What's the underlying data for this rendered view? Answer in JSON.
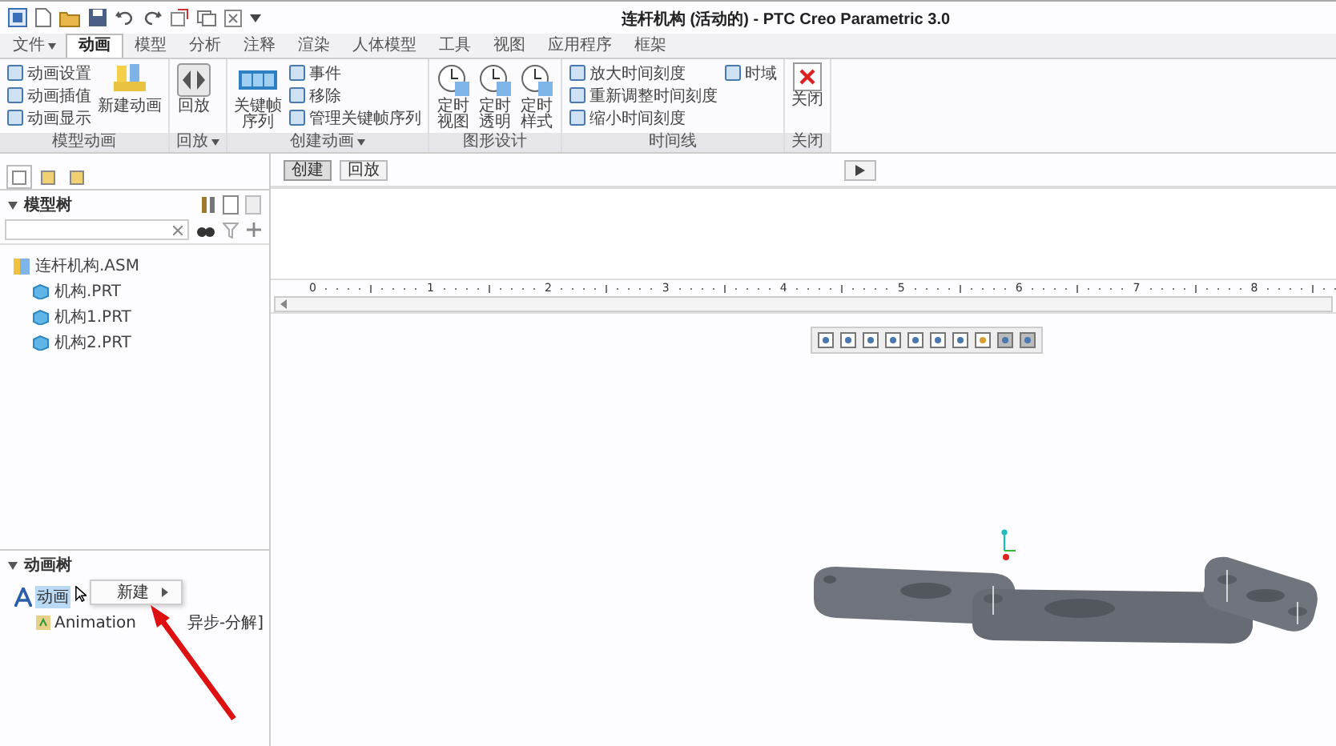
{
  "window": {
    "title": "连杆机构 (活动的) - PTC Creo Parametric 3.0"
  },
  "tabs": [
    {
      "label": "文件",
      "kind": "menu",
      "selected": false
    },
    {
      "label": "动画",
      "kind": "tab",
      "selected": true
    },
    {
      "label": "模型",
      "kind": "tab",
      "selected": false
    },
    {
      "label": "分析",
      "kind": "tab",
      "selected": false
    },
    {
      "label": "注释",
      "kind": "tab",
      "selected": false
    },
    {
      "label": "渲染",
      "kind": "tab",
      "selected": false
    },
    {
      "label": "人体模型",
      "kind": "tab",
      "selected": false
    },
    {
      "label": "工具",
      "kind": "tab",
      "selected": false
    },
    {
      "label": "视图",
      "kind": "tab",
      "selected": false
    },
    {
      "label": "应用程序",
      "kind": "tab",
      "selected": false
    },
    {
      "label": "框架",
      "kind": "tab",
      "selected": false
    }
  ],
  "ribbon_groups": [
    {
      "label": "模型动画",
      "dropdown": false,
      "columns": [
        {
          "kind": "small",
          "items": [
            "动画设置",
            "动画插值",
            "动画显示"
          ]
        },
        {
          "kind": "large",
          "items": [
            {
              "label": "新建动画"
            }
          ]
        }
      ]
    },
    {
      "label": "回放",
      "dropdown": true,
      "columns": [
        {
          "kind": "large",
          "items": [
            {
              "label": "回放"
            }
          ]
        }
      ]
    },
    {
      "label": "创建动画",
      "dropdown": true,
      "columns": [
        {
          "kind": "large",
          "items": [
            {
              "label": "关键帧序列"
            }
          ]
        },
        {
          "kind": "small",
          "items": [
            "事件",
            "移除",
            "管理关键帧序列"
          ]
        }
      ]
    },
    {
      "label": "图形设计",
      "dropdown": false,
      "columns": [
        {
          "kind": "large",
          "items": [
            {
              "label": "定时视图"
            },
            {
              "label": "定时透明"
            },
            {
              "label": "定时样式"
            }
          ]
        }
      ]
    },
    {
      "label": "时间线",
      "dropdown": false,
      "columns": [
        {
          "kind": "small",
          "items": [
            "放大时间刻度",
            "重新调整时间刻度",
            "缩小时间刻度"
          ]
        },
        {
          "kind": "small",
          "items": [
            "时域"
          ]
        }
      ]
    },
    {
      "label": "关闭",
      "dropdown": false,
      "columns": [
        {
          "kind": "large",
          "items": [
            {
              "label": "关闭"
            }
          ]
        }
      ]
    }
  ],
  "panel_tabs": [
    {
      "selected": true
    },
    {
      "selected": false
    },
    {
      "selected": false
    }
  ],
  "model_tree": {
    "title": "模型树",
    "items": [
      {
        "label": "连杆机构.ASM",
        "expanded": true,
        "children": [
          {
            "label": "机构.PRT"
          },
          {
            "label": "机构1.PRT"
          },
          {
            "label": "机构2.PRT"
          }
        ]
      }
    ]
  },
  "animation_tree": {
    "title": "动画树",
    "root": {
      "label": "动画",
      "selected": true
    },
    "item_start": "Animation",
    "item_end": "异步-分解]"
  },
  "context_menu": {
    "items": [
      {
        "label": "新建",
        "submenu": true
      }
    ]
  },
  "timeline": {
    "buttons": [
      {
        "label": "创建",
        "selected": true
      },
      {
        "label": "回放",
        "selected": false
      }
    ],
    "ruler": [
      "0",
      "1",
      "2",
      "3",
      "4",
      "5",
      "6",
      "7",
      "8"
    ]
  }
}
